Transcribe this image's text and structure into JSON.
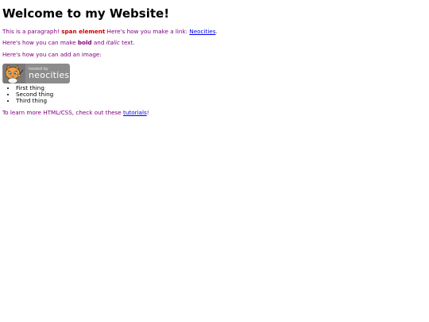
{
  "heading": "Welcome to my Website!",
  "para1": {
    "lead": "This is a paragraph! ",
    "span_text": "span element",
    "middle": " Here's how you make a link: ",
    "link": "Neocities",
    "end": "."
  },
  "para2": {
    "lead": "Here's how you can make ",
    "bold": "bold",
    "middle": " and ",
    "italic": "italic",
    "end": " text."
  },
  "para3": "Here's how you can add an image:",
  "badge": {
    "small_text": "hosted by",
    "big_text": "neocities",
    "icon": "neocities-cat-icon"
  },
  "list": [
    "First thing",
    "Second thing",
    "Third thing"
  ],
  "para4": {
    "lead": "To learn more HTML/CSS, check out these ",
    "link": "tutorials",
    "end": "!"
  },
  "colors": {
    "text": "#800080",
    "span": "#cc0000",
    "link": "#0000ee"
  }
}
